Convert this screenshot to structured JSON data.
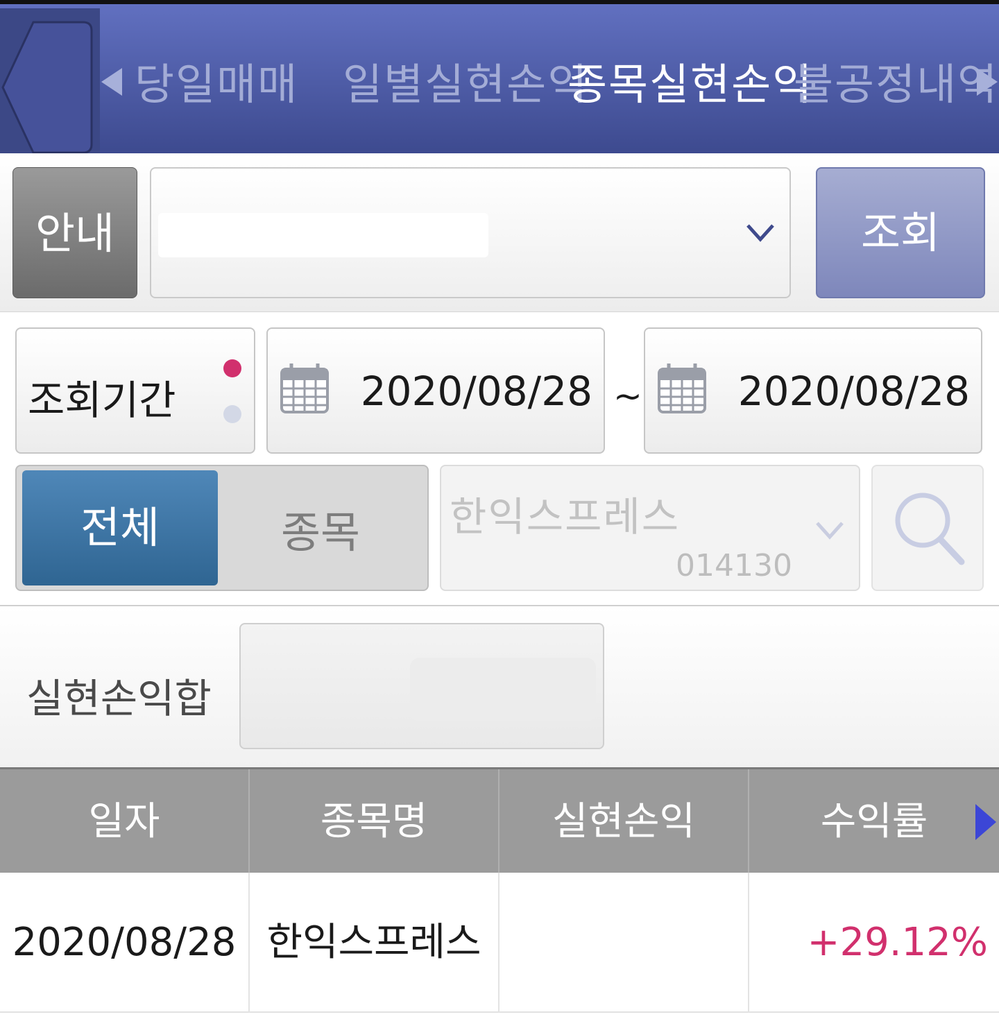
{
  "nav": {
    "tabs": [
      {
        "label": "당일매매",
        "active": false
      },
      {
        "label": "일별실현손익",
        "active": false
      },
      {
        "label": "종목실현손익",
        "active": true
      },
      {
        "label": "불공정내역",
        "active": false
      }
    ]
  },
  "account": {
    "info_label": "안내",
    "query_label": "조회"
  },
  "filter": {
    "period_label": "조회기간",
    "start_date": "2020/08/28",
    "separator": "~",
    "end_date": "2020/08/28",
    "segment_all": "전체",
    "segment_stock": "종목",
    "stock_name": "한익스프레스",
    "stock_code": "014130"
  },
  "summary": {
    "label": "실현손익합"
  },
  "table": {
    "headers": [
      "일자",
      "종목명",
      "실현손익",
      "수익률"
    ],
    "rows": [
      {
        "date": "2020/08/28",
        "name": "한익스프레스",
        "profit": "",
        "rate": "+29.12%"
      }
    ]
  },
  "colors": {
    "nav_bg": "#4f5ca8",
    "segment_active": "#3d75a6",
    "rate_positive": "#d1306d",
    "dot_active": "#d1306d",
    "dot_inactive": "#d3d8e6"
  }
}
